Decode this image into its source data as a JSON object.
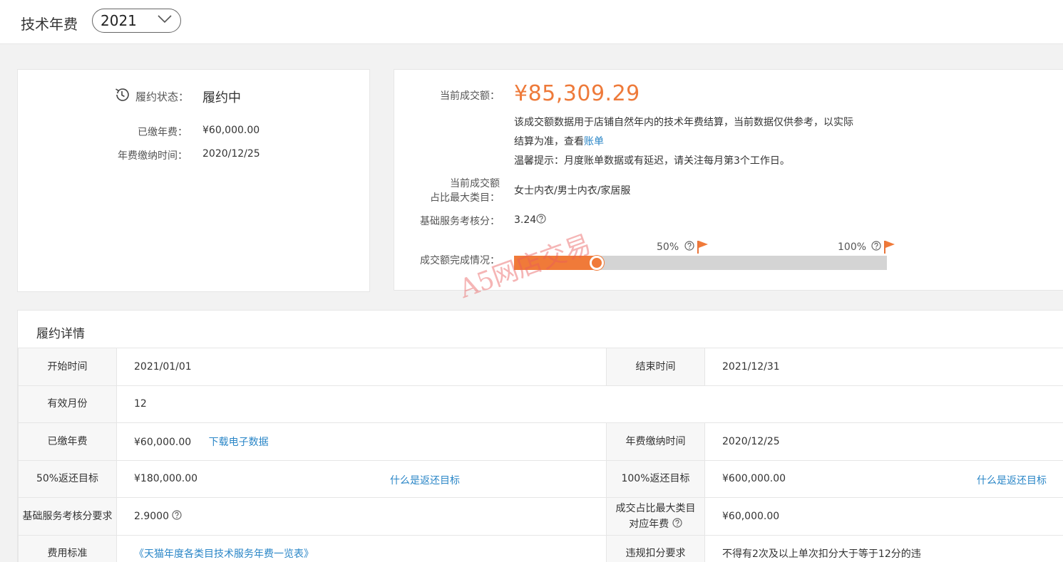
{
  "header": {
    "title": "技术年费",
    "year_selected": "2021"
  },
  "summary_left": {
    "status_label": "履约状态：",
    "status_value": "履约中",
    "paid_label": "已缴年费：",
    "paid_value": "¥60,000.00",
    "paytime_label": "年费缴纳时间：",
    "paytime_value": "2020/12/25"
  },
  "summary_right": {
    "turnover_label": "当前成交额：",
    "turnover_value": "¥85,309.29",
    "desc_line1": "该成交额数据用于店铺自然年内的技术年费结算，当前数据仅供参考，以实际",
    "desc_line2_prefix": "结算为准，查看",
    "desc_line2_link": "账单",
    "tip": "温馨提示：月度账单数据或有延迟，请关注每月第3个工作日。",
    "top_category_label_1": "当前成交额",
    "top_category_label_2": "占比最大类目：",
    "top_category_value": "女士内衣/男士内衣/家居服",
    "score_label": "基础服务考核分：",
    "score_value": "3.24",
    "progress_label": "成交额完成情况：",
    "progress_fraction": 0.23,
    "marker_50": "50%",
    "marker_100": "100%"
  },
  "details": {
    "title": "履约详情",
    "rows": {
      "start_label": "开始时间",
      "start_value": "2021/01/01",
      "end_label": "结束时间",
      "end_value": "2021/12/31",
      "months_label": "有效月份",
      "months_value": "12",
      "paid_label": "已缴年费",
      "paid_value": "¥60,000.00",
      "download_link": "下载电子数据",
      "paytime_label": "年费缴纳时间",
      "paytime_value": "2020/12/25",
      "target50_label": "50%返还目标",
      "target50_value": "¥180,000.00",
      "target_help_link": "什么是返还目标",
      "target100_label": "100%返还目标",
      "target100_value": "¥600,000.00",
      "score_req_label": "基础服务考核分要求",
      "score_req_value": "2.9000",
      "category_fee_label_1": "成交占比最大类目",
      "category_fee_label_2": "对应年费",
      "category_fee_value": "¥60,000.00",
      "fee_std_label": "费用标准",
      "fee_std_value": "《天猫年度各类目技术服务年费一览表》",
      "violation_label": "违规扣分要求",
      "violation_value": "不得有2次及以上单次扣分大于等于12分的违"
    }
  },
  "watermark": "A5网店交易",
  "colors": {
    "accent": "#ee7a3a",
    "link": "#2a86c7",
    "track": "#d4d4d4"
  }
}
